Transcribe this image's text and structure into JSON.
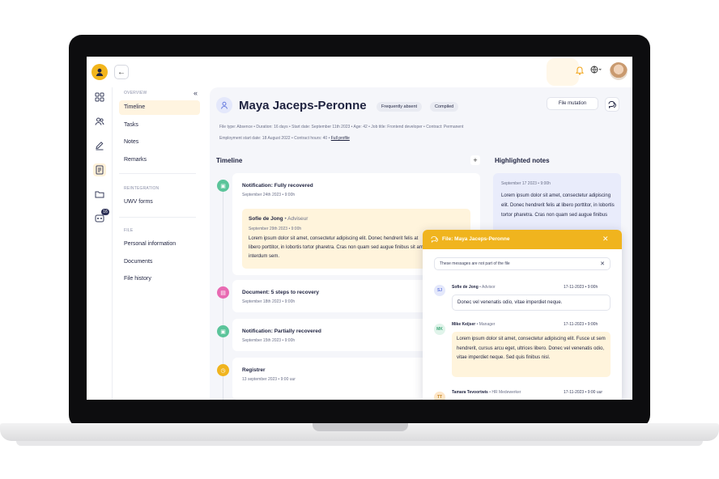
{
  "topbar": {
    "back_icon": "arrow-left-icon",
    "bell_icon": "bell-icon",
    "globe_icon": "globe-icon"
  },
  "rail": {
    "badge": "16"
  },
  "nav": {
    "sections": {
      "overview": "OVERVIEW",
      "reintegration": "REINTEGRATION",
      "file": "FILE"
    },
    "items": [
      "Timeline",
      "Tasks",
      "Notes",
      "Remarks",
      "UWV forms",
      "Personal information",
      "Documents",
      "File history"
    ],
    "active": "Timeline"
  },
  "header": {
    "name": "Maya Jaceps-Peronne",
    "chips": [
      "Frequently absent",
      "Compiled"
    ],
    "file_mutation": "File mutation",
    "meta_line1": "File type: Absence  •  Duration: 16 days  •  Start date: September 11th 2023  •  Age: 42  •  Job title: Frontend developer  •  Contract: Permanent",
    "meta_line2": "Employment start date: 18 August 2022  •  Contract hours: 40  •",
    "full_profile": "Full profile"
  },
  "timeline": {
    "title": "Timeline",
    "add": "+",
    "events": [
      {
        "title": "Notification: Fully recovered",
        "date": "September 24th 2023  •  9:00h",
        "color": "#5bc49a"
      },
      {
        "title": "Document: 5 steps to recovery",
        "date": "September 18th 2023  •  9:00h",
        "color": "#e86ab2"
      },
      {
        "title": "Notification: Partially recovered",
        "date": "September 15th 2023  •  9:00h",
        "color": "#5bc49a"
      },
      {
        "title": "Registrer",
        "date": "13 september 2023  •  9:00 uur",
        "color": "#f0b41e"
      }
    ],
    "note": {
      "author": "Sofie de Jong",
      "role": "•  Adviseur",
      "date": "September 29th 2023  •  9:00h",
      "text": "Lorem ipsum dolor sit amet, consectetur adipiscing elit. Donec hendrerit felis at libero porttitor, in lobortis tortor pharetra. Cras non quam sed augue finibus sit amet interdum sem."
    }
  },
  "highlighted": {
    "title": "Highlighted notes",
    "date": "September 17 2023  •  9:00h",
    "text": "Lorem ipsum dolor sit amet, consectetur adipiscing elit. Donec hendrerit felis at libero porttitor, in lobortis tortor pharetra. Cras non quam sed augue finibus"
  },
  "file_panel": {
    "title": "File: Maya Jaceps-Peronne",
    "info": "These messages are not part of the file",
    "messages": [
      {
        "initials": "SJ",
        "author": "Sofie de Jong",
        "role": "•  Advisor",
        "time": "17-11-2023  •  9:00h",
        "text": "Donec vel venenatis odio, vitae imperdiet neque."
      },
      {
        "initials": "MK",
        "author": "Mike Keijser",
        "role": "•  Manager",
        "time": "17-11-2023  •  9:00h",
        "text": "Lorem ipsum dolor sit amet, consectetur adipiscing elit. Fusce ut sem hendrerit, cursus arcu eget, ultrices libero. Donec vel venenatis odio, vitae imperdiet neque. Sed quis finibus nisl."
      },
      {
        "initials": "TT",
        "author": "Tamara Tevoortwis",
        "role": "•  HR Medewerker",
        "time": "17-11-2023  •  9:00 uur",
        "text": ""
      }
    ]
  },
  "colors": {
    "accent": "#f0b41e",
    "navy": "#1f2340",
    "main_bg": "#f5f6fa"
  }
}
